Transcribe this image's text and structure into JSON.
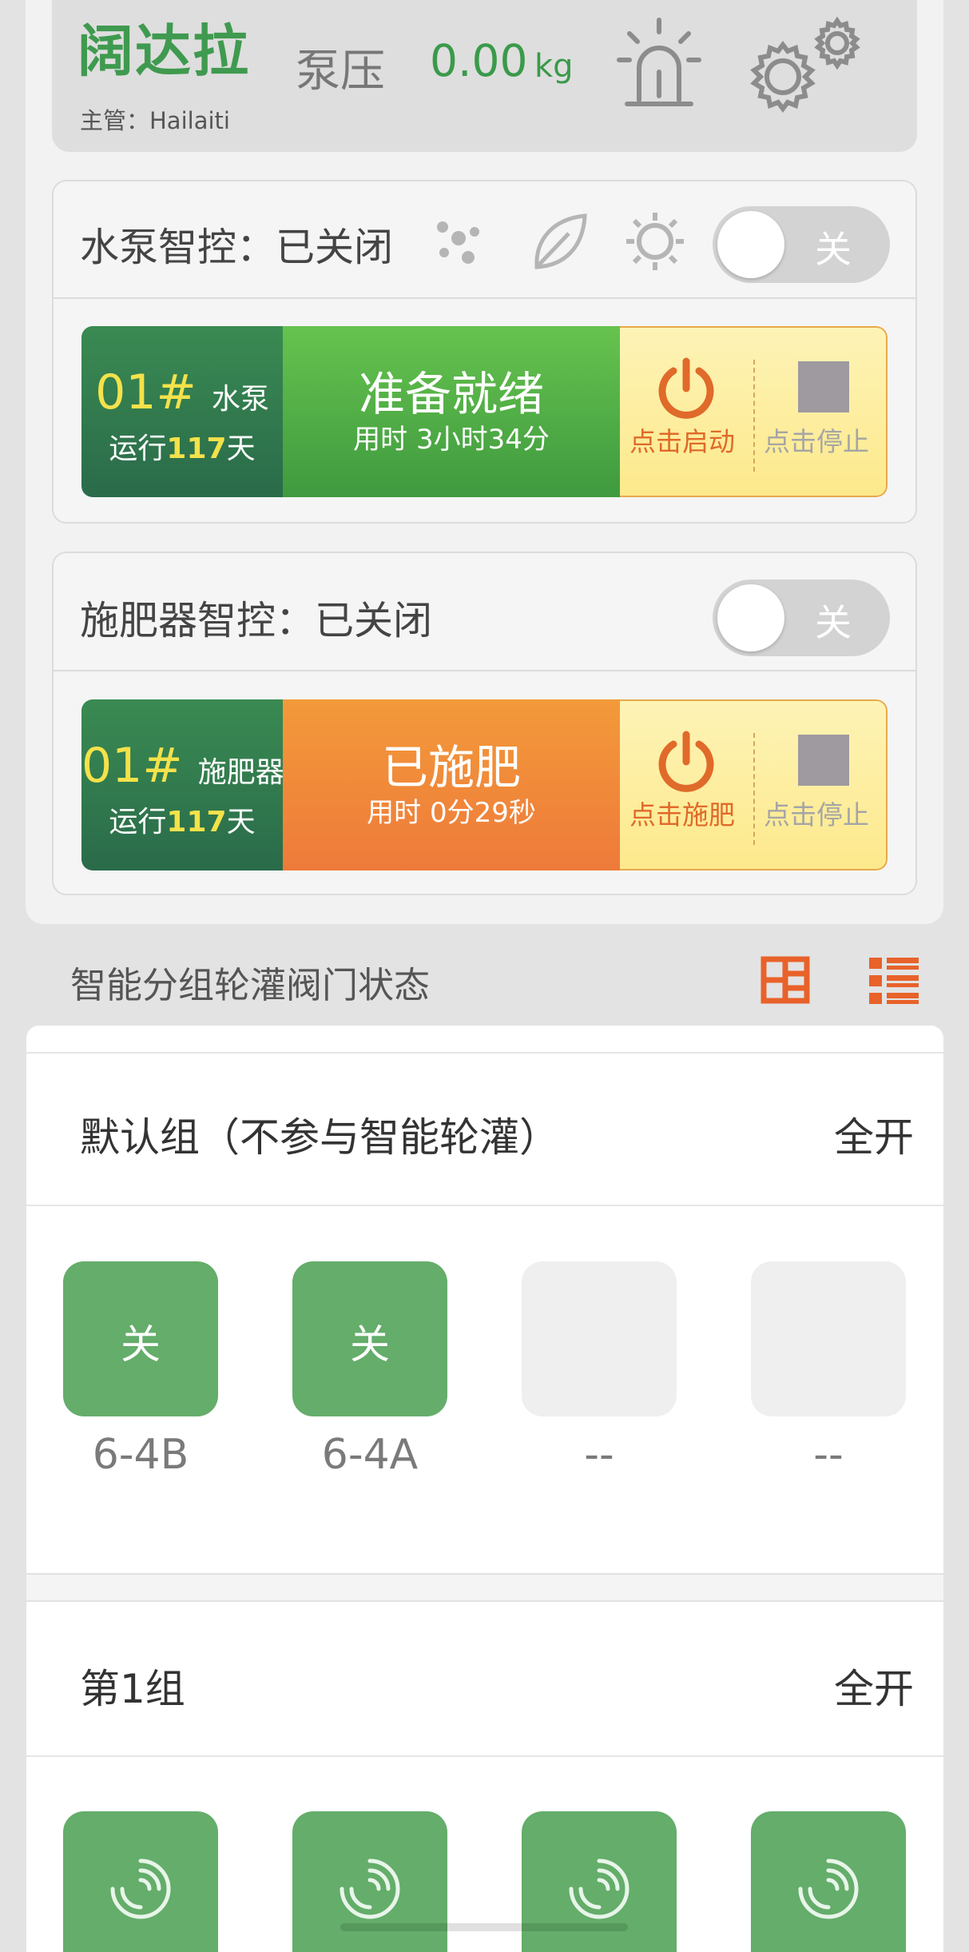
{
  "header": {
    "farm_name": "阔达拉",
    "manager": "主管：Hailaiti",
    "pressure_label": "泵压",
    "pressure_value": "0.00",
    "pressure_unit": "kg"
  },
  "pump_section": {
    "title": "水泵智控：已关闭",
    "toggle_label": "关",
    "device": {
      "number": "01#",
      "name": "水泵",
      "run_prefix": "运行",
      "run_days": "117",
      "run_suffix": "天",
      "status": "准备就绪",
      "time_used": "用时 3小时34分",
      "start_label": "点击启动",
      "stop_label": "点击停止"
    }
  },
  "fert_section": {
    "title": "施肥器智控：已关闭",
    "toggle_label": "关",
    "device": {
      "number": "01#",
      "name": "施肥器",
      "run_prefix": "运行",
      "run_days": "117",
      "run_suffix": "天",
      "status": "已施肥",
      "time_used": "用时 0分29秒",
      "start_label": "点击施肥",
      "stop_label": "点击停止"
    }
  },
  "valve_status": {
    "title": "智能分组轮灌阀门状态"
  },
  "groups": [
    {
      "name": "默认组（不参与智能轮灌）",
      "all_open": "全开",
      "valves": [
        {
          "state": "关",
          "label": "6-4B"
        },
        {
          "state": "关",
          "label": "6-4A"
        },
        {
          "state": "",
          "label": "--"
        },
        {
          "state": "",
          "label": "--"
        }
      ]
    },
    {
      "name": "第1组",
      "all_open": "全开"
    }
  ],
  "colors": {
    "brand_green": "#3f9a4f",
    "ready_green": "#4caf50",
    "fert_orange": "#f0813a",
    "action_orange": "#e06a2a",
    "valve_green": "#64ad6a"
  }
}
